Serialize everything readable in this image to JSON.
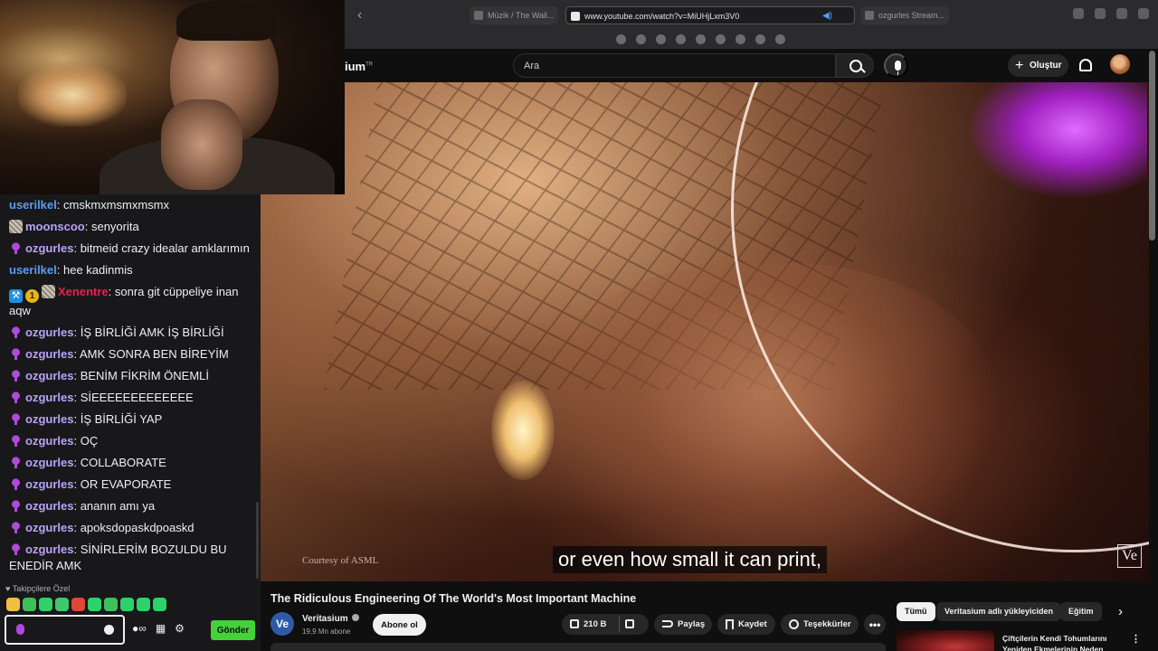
{
  "browser": {
    "tabs": [
      {
        "label": "Müzik / The Wall...",
        "active": false
      },
      {
        "label": "www.youtube.com/watch?v=MiUHjLxm3V0",
        "active": true
      },
      {
        "label": "ozgurles Stream...",
        "active": false
      }
    ]
  },
  "youtube": {
    "logo_text": "ium",
    "logo_sup": "TR",
    "search_placeholder": "Ara",
    "create_label": "Oluştur",
    "video": {
      "courtesy": "Courtesy of ASML",
      "caption": "or even how small it can print,",
      "watermark": "Ve"
    },
    "title": "The Ridiculous Engineering Of The World's Most Important Machine",
    "channel": {
      "avatar": "Ve",
      "name": "Veritasium",
      "subscribers": "19,9 Mn abone",
      "subscribe_label": "Abone ol"
    },
    "actions": {
      "likes": "210 B",
      "share": "Paylaş",
      "save": "Kaydet",
      "thanks": "Teşekkürler",
      "more": "•••"
    },
    "chips": [
      "Tümü",
      "Veritasium adlı yükleyiciden",
      "Eğitim"
    ],
    "recommendation": {
      "title": "Çiftçilerin Kendi Tohumlarını Yeniden Ekmelerinin Neden"
    }
  },
  "chat": {
    "messages": [
      {
        "badges": [],
        "user": "userilkel",
        "color": "blue",
        "text": "cmskmxmsmxmsmx"
      },
      {
        "badges": [
          "img"
        ],
        "user": "moonscoo",
        "color": "purple",
        "text": "senyorita"
      },
      {
        "badges": [
          "mic"
        ],
        "user": "ozgurles",
        "color": "purple",
        "text": "bitmeid crazy idealar amklarımın"
      },
      {
        "badges": [],
        "user": "userilkel",
        "color": "blue",
        "text": "hee kadinmis"
      },
      {
        "badges": [
          "hammer",
          "gold",
          "img"
        ],
        "user": "Xenentre",
        "color": "red",
        "text": "sonra git cüppeliye inan aqw"
      },
      {
        "badges": [
          "mic"
        ],
        "user": "ozgurles",
        "color": "purple",
        "text": "İŞ BİRLİĞİ AMK İŞ BİRLİĞİ"
      },
      {
        "badges": [
          "mic"
        ],
        "user": "ozgurles",
        "color": "purple",
        "text": "AMK SONRA BEN BİREYİM"
      },
      {
        "badges": [
          "mic"
        ],
        "user": "ozgurles",
        "color": "purple",
        "text": "BENİM FİKRİM ÖNEMLİ"
      },
      {
        "badges": [
          "mic"
        ],
        "user": "ozgurles",
        "color": "purple",
        "text": "SİEEEEEEEEEEEEE"
      },
      {
        "badges": [
          "mic"
        ],
        "user": "ozgurles",
        "color": "purple",
        "text": "İŞ BİRLİĞİ YAP"
      },
      {
        "badges": [
          "mic"
        ],
        "user": "ozgurles",
        "color": "purple",
        "text": "OÇ"
      },
      {
        "badges": [
          "mic"
        ],
        "user": "ozgurles",
        "color": "purple",
        "text": "COLLABORATE"
      },
      {
        "badges": [
          "mic"
        ],
        "user": "ozgurles",
        "color": "purple",
        "text": "OR EVAPORATE"
      },
      {
        "badges": [
          "mic"
        ],
        "user": "ozgurles",
        "color": "purple",
        "text": "ananın amı ya"
      },
      {
        "badges": [
          "mic"
        ],
        "user": "ozgurles",
        "color": "purple",
        "text": "apoksdopaskdpoaskd"
      },
      {
        "badges": [
          "mic"
        ],
        "user": "ozgurles",
        "color": "purple",
        "text": "SİNİRLERİM BOZULDU BU ENEDİR AMK"
      }
    ],
    "followers_label": "Takipçilere Özel",
    "emote_colors": [
      "#f0c040",
      "#3fbf5a",
      "#2fd16a",
      "#3cc96a",
      "#e0463a",
      "#2fd16a",
      "#3fbf5a",
      "#2fd16a",
      "#2fd16a",
      "#2fd16a"
    ],
    "input_value": "",
    "send_label": "Gönder",
    "colors": {
      "accent_send": "#45d13a",
      "mic_badge": "#b04ad8"
    }
  }
}
